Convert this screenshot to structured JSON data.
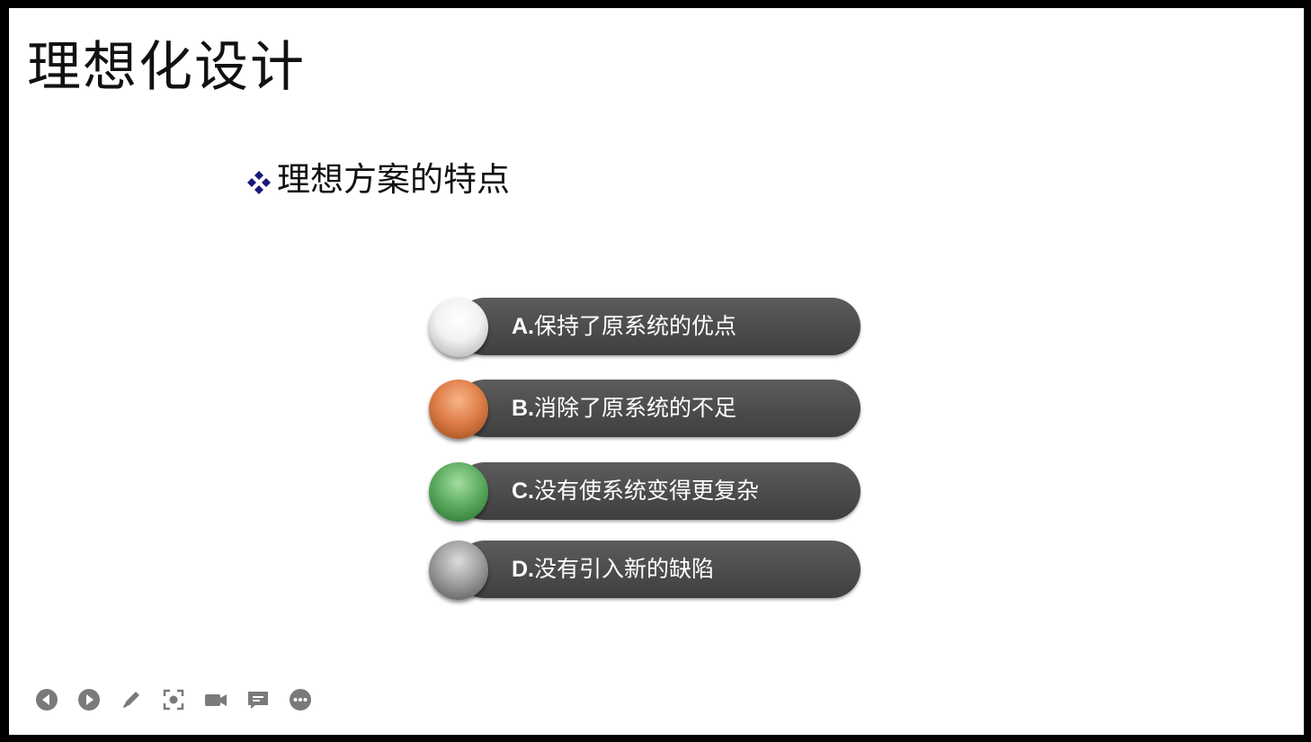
{
  "slide": {
    "title": "理想化设计",
    "subtitle": "理想方案的特点"
  },
  "items": [
    {
      "letter": "A.",
      "text": "保持了原系统的优点",
      "ball_color": "white"
    },
    {
      "letter": "B.",
      "text": "消除了原系统的不足",
      "ball_color": "orange"
    },
    {
      "letter": "C.",
      "text": "没有使系统变得更复杂",
      "ball_color": "green"
    },
    {
      "letter": "D.",
      "text": "没有引入新的缺陷",
      "ball_color": "gray"
    }
  ],
  "toolbar": {
    "icons": [
      "previous-icon",
      "next-icon",
      "pen-icon",
      "screenshot-icon",
      "camera-icon",
      "comment-icon",
      "more-icon"
    ]
  },
  "colors": {
    "bullet": "#1a1a7a",
    "pill": "#4d4d4d",
    "toolbar_icon": "#7a7a7a"
  }
}
